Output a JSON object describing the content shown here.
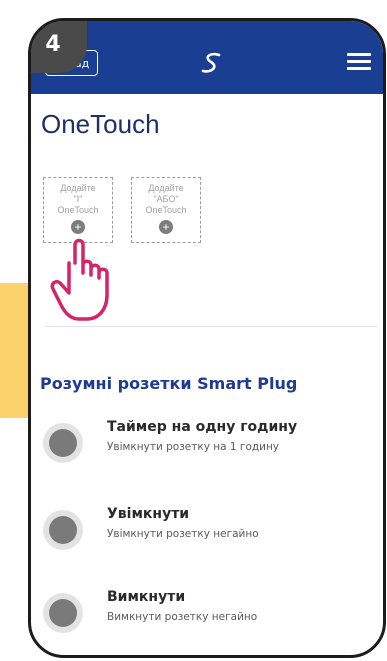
{
  "step_number": "4",
  "header": {
    "back_label": "Назад",
    "logo_icon": "swirl-logo-icon",
    "menu_icon": "hamburger-menu-icon"
  },
  "title": "OneTouch",
  "onetouch_tiles": [
    {
      "label_line1": "Додайте",
      "label_line2": "\"I\"",
      "label_line3": "OneTouch"
    },
    {
      "label_line1": "Додайте",
      "label_line2": "\"АБО\"",
      "label_line3": "OneTouch"
    }
  ],
  "section_title": "Розумні розетки Smart Plug",
  "items": [
    {
      "name": "Таймер на одну годину",
      "description": "Увімкнути розетку на 1 годину"
    },
    {
      "name": "Увімкнути",
      "description": "Увімкнути розетку негайно"
    },
    {
      "name": "Вимкнути",
      "description": "Вимкнути розетку негайно"
    }
  ],
  "colors": {
    "header": "#1a3f92",
    "accent_arrow": "#fcd26a",
    "pointer_hand": "#d4246a"
  }
}
